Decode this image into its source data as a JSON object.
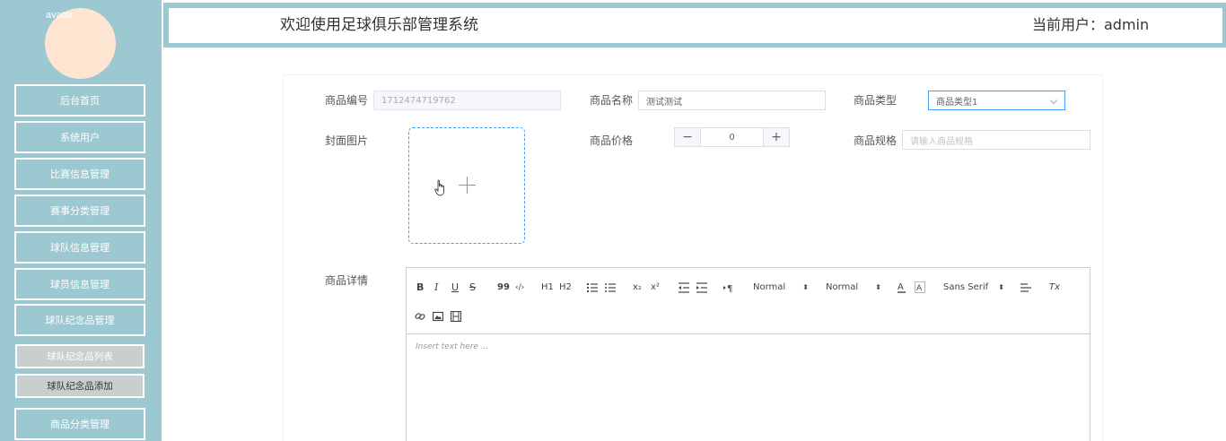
{
  "header": {
    "title": "欢迎使用足球俱乐部管理系统",
    "user_label": "当前用户：admin"
  },
  "sidebar": {
    "avatar_alt": "avatar",
    "items": [
      {
        "label": "后台首页"
      },
      {
        "label": "系统用户"
      },
      {
        "label": "比赛信息管理"
      },
      {
        "label": "赛事分类管理"
      },
      {
        "label": "球队信息管理"
      },
      {
        "label": "球员信息管理"
      },
      {
        "label": "球队纪念品管理"
      },
      {
        "label": "商品分类管理"
      }
    ],
    "subitems": [
      {
        "label": "球队纪念品列表"
      },
      {
        "label": "球队纪念品添加"
      }
    ]
  },
  "form": {
    "code": {
      "label": "商品编号",
      "value": "1712474719762"
    },
    "name": {
      "label": "商品名称",
      "value": "测试测试"
    },
    "type": {
      "label": "商品类型",
      "value": "商品类型1"
    },
    "cover": {
      "label": "封面图片"
    },
    "price": {
      "label": "商品价格",
      "value": "0",
      "minus": "−",
      "plus": "+"
    },
    "spec": {
      "label": "商品规格",
      "placeholder": "请输入商品规格"
    },
    "detail": {
      "label": "商品详情"
    }
  },
  "editor": {
    "heading_select": "Normal",
    "size_select": "Normal",
    "font_select": "Sans Serif",
    "placeholder": "Insert text here ...",
    "buttons": {
      "bold": "B",
      "italic": "I",
      "underline": "U",
      "strike": "S",
      "quote": "99",
      "code": "‹/›",
      "h1": "H1",
      "h2": "H2",
      "sub": "x₂",
      "sup": "x²",
      "clean": "Tx"
    }
  },
  "colors": {
    "sidebar": "#9cc8d2",
    "accent": "#409eff",
    "avatar": "#fde5d2"
  }
}
